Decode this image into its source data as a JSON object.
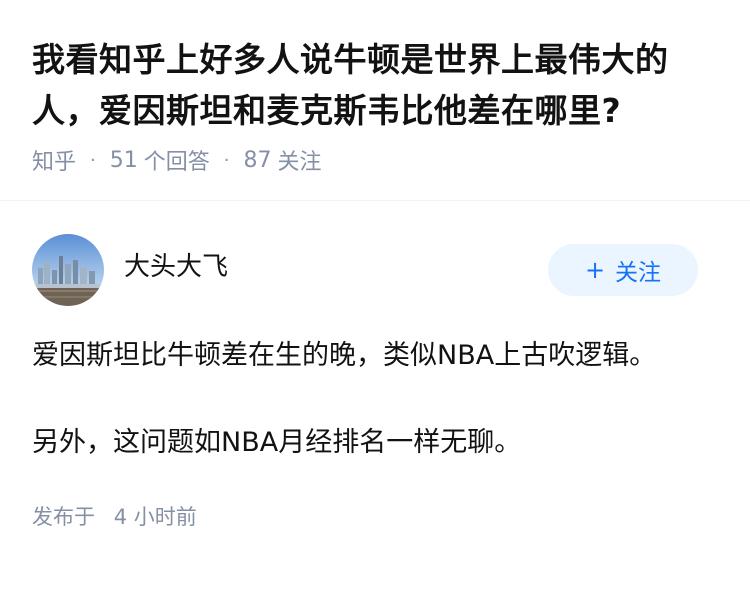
{
  "question": {
    "title": "我看知乎上好多人说牛顿是世界上最伟大的人，爱因斯坦和麦克斯韦比他差在哪里?",
    "source": "知乎",
    "answer_count": "51",
    "answer_label": "个回答",
    "follow_count": "87",
    "follow_label": "关注"
  },
  "answer": {
    "author_name": "大头大飞",
    "avatar_icon": "city-skyline-avatar",
    "follow_button_plus": "+",
    "follow_button_label": "关注",
    "paragraphs": [
      "爱因斯坦比牛顿差在生的晚，类似NBA上古吹逻辑。",
      "另外，这问题如NBA月经排名一样无聊。"
    ],
    "publish_label": "发布于",
    "publish_time": "4 小时前"
  },
  "colors": {
    "meta_gray": "#8590a6",
    "accent_blue": "#1772f6",
    "follow_bg": "#ebf5ff"
  }
}
